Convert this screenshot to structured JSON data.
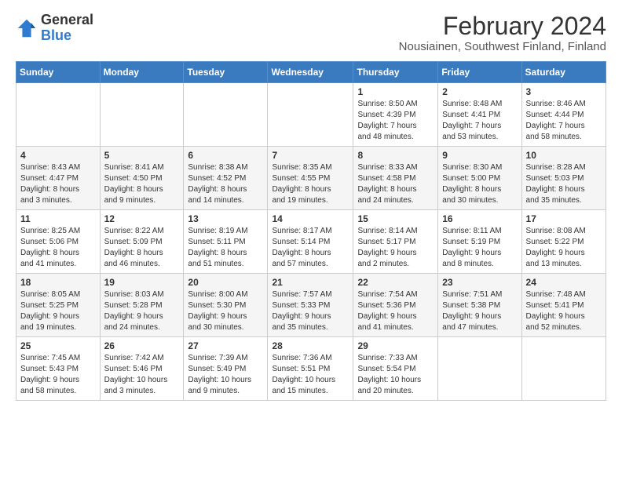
{
  "logo": {
    "general": "General",
    "blue": "Blue"
  },
  "title": "February 2024",
  "subtitle": "Nousiainen, Southwest Finland, Finland",
  "days_header": [
    "Sunday",
    "Monday",
    "Tuesday",
    "Wednesday",
    "Thursday",
    "Friday",
    "Saturday"
  ],
  "weeks": [
    [
      {
        "day": "",
        "detail": ""
      },
      {
        "day": "",
        "detail": ""
      },
      {
        "day": "",
        "detail": ""
      },
      {
        "day": "",
        "detail": ""
      },
      {
        "day": "1",
        "detail": "Sunrise: 8:50 AM\nSunset: 4:39 PM\nDaylight: 7 hours\nand 48 minutes."
      },
      {
        "day": "2",
        "detail": "Sunrise: 8:48 AM\nSunset: 4:41 PM\nDaylight: 7 hours\nand 53 minutes."
      },
      {
        "day": "3",
        "detail": "Sunrise: 8:46 AM\nSunset: 4:44 PM\nDaylight: 7 hours\nand 58 minutes."
      }
    ],
    [
      {
        "day": "4",
        "detail": "Sunrise: 8:43 AM\nSunset: 4:47 PM\nDaylight: 8 hours\nand 3 minutes."
      },
      {
        "day": "5",
        "detail": "Sunrise: 8:41 AM\nSunset: 4:50 PM\nDaylight: 8 hours\nand 9 minutes."
      },
      {
        "day": "6",
        "detail": "Sunrise: 8:38 AM\nSunset: 4:52 PM\nDaylight: 8 hours\nand 14 minutes."
      },
      {
        "day": "7",
        "detail": "Sunrise: 8:35 AM\nSunset: 4:55 PM\nDaylight: 8 hours\nand 19 minutes."
      },
      {
        "day": "8",
        "detail": "Sunrise: 8:33 AM\nSunset: 4:58 PM\nDaylight: 8 hours\nand 24 minutes."
      },
      {
        "day": "9",
        "detail": "Sunrise: 8:30 AM\nSunset: 5:00 PM\nDaylight: 8 hours\nand 30 minutes."
      },
      {
        "day": "10",
        "detail": "Sunrise: 8:28 AM\nSunset: 5:03 PM\nDaylight: 8 hours\nand 35 minutes."
      }
    ],
    [
      {
        "day": "11",
        "detail": "Sunrise: 8:25 AM\nSunset: 5:06 PM\nDaylight: 8 hours\nand 41 minutes."
      },
      {
        "day": "12",
        "detail": "Sunrise: 8:22 AM\nSunset: 5:09 PM\nDaylight: 8 hours\nand 46 minutes."
      },
      {
        "day": "13",
        "detail": "Sunrise: 8:19 AM\nSunset: 5:11 PM\nDaylight: 8 hours\nand 51 minutes."
      },
      {
        "day": "14",
        "detail": "Sunrise: 8:17 AM\nSunset: 5:14 PM\nDaylight: 8 hours\nand 57 minutes."
      },
      {
        "day": "15",
        "detail": "Sunrise: 8:14 AM\nSunset: 5:17 PM\nDaylight: 9 hours\nand 2 minutes."
      },
      {
        "day": "16",
        "detail": "Sunrise: 8:11 AM\nSunset: 5:19 PM\nDaylight: 9 hours\nand 8 minutes."
      },
      {
        "day": "17",
        "detail": "Sunrise: 8:08 AM\nSunset: 5:22 PM\nDaylight: 9 hours\nand 13 minutes."
      }
    ],
    [
      {
        "day": "18",
        "detail": "Sunrise: 8:05 AM\nSunset: 5:25 PM\nDaylight: 9 hours\nand 19 minutes."
      },
      {
        "day": "19",
        "detail": "Sunrise: 8:03 AM\nSunset: 5:28 PM\nDaylight: 9 hours\nand 24 minutes."
      },
      {
        "day": "20",
        "detail": "Sunrise: 8:00 AM\nSunset: 5:30 PM\nDaylight: 9 hours\nand 30 minutes."
      },
      {
        "day": "21",
        "detail": "Sunrise: 7:57 AM\nSunset: 5:33 PM\nDaylight: 9 hours\nand 35 minutes."
      },
      {
        "day": "22",
        "detail": "Sunrise: 7:54 AM\nSunset: 5:36 PM\nDaylight: 9 hours\nand 41 minutes."
      },
      {
        "day": "23",
        "detail": "Sunrise: 7:51 AM\nSunset: 5:38 PM\nDaylight: 9 hours\nand 47 minutes."
      },
      {
        "day": "24",
        "detail": "Sunrise: 7:48 AM\nSunset: 5:41 PM\nDaylight: 9 hours\nand 52 minutes."
      }
    ],
    [
      {
        "day": "25",
        "detail": "Sunrise: 7:45 AM\nSunset: 5:43 PM\nDaylight: 9 hours\nand 58 minutes."
      },
      {
        "day": "26",
        "detail": "Sunrise: 7:42 AM\nSunset: 5:46 PM\nDaylight: 10 hours\nand 3 minutes."
      },
      {
        "day": "27",
        "detail": "Sunrise: 7:39 AM\nSunset: 5:49 PM\nDaylight: 10 hours\nand 9 minutes."
      },
      {
        "day": "28",
        "detail": "Sunrise: 7:36 AM\nSunset: 5:51 PM\nDaylight: 10 hours\nand 15 minutes."
      },
      {
        "day": "29",
        "detail": "Sunrise: 7:33 AM\nSunset: 5:54 PM\nDaylight: 10 hours\nand 20 minutes."
      },
      {
        "day": "",
        "detail": ""
      },
      {
        "day": "",
        "detail": ""
      }
    ]
  ]
}
